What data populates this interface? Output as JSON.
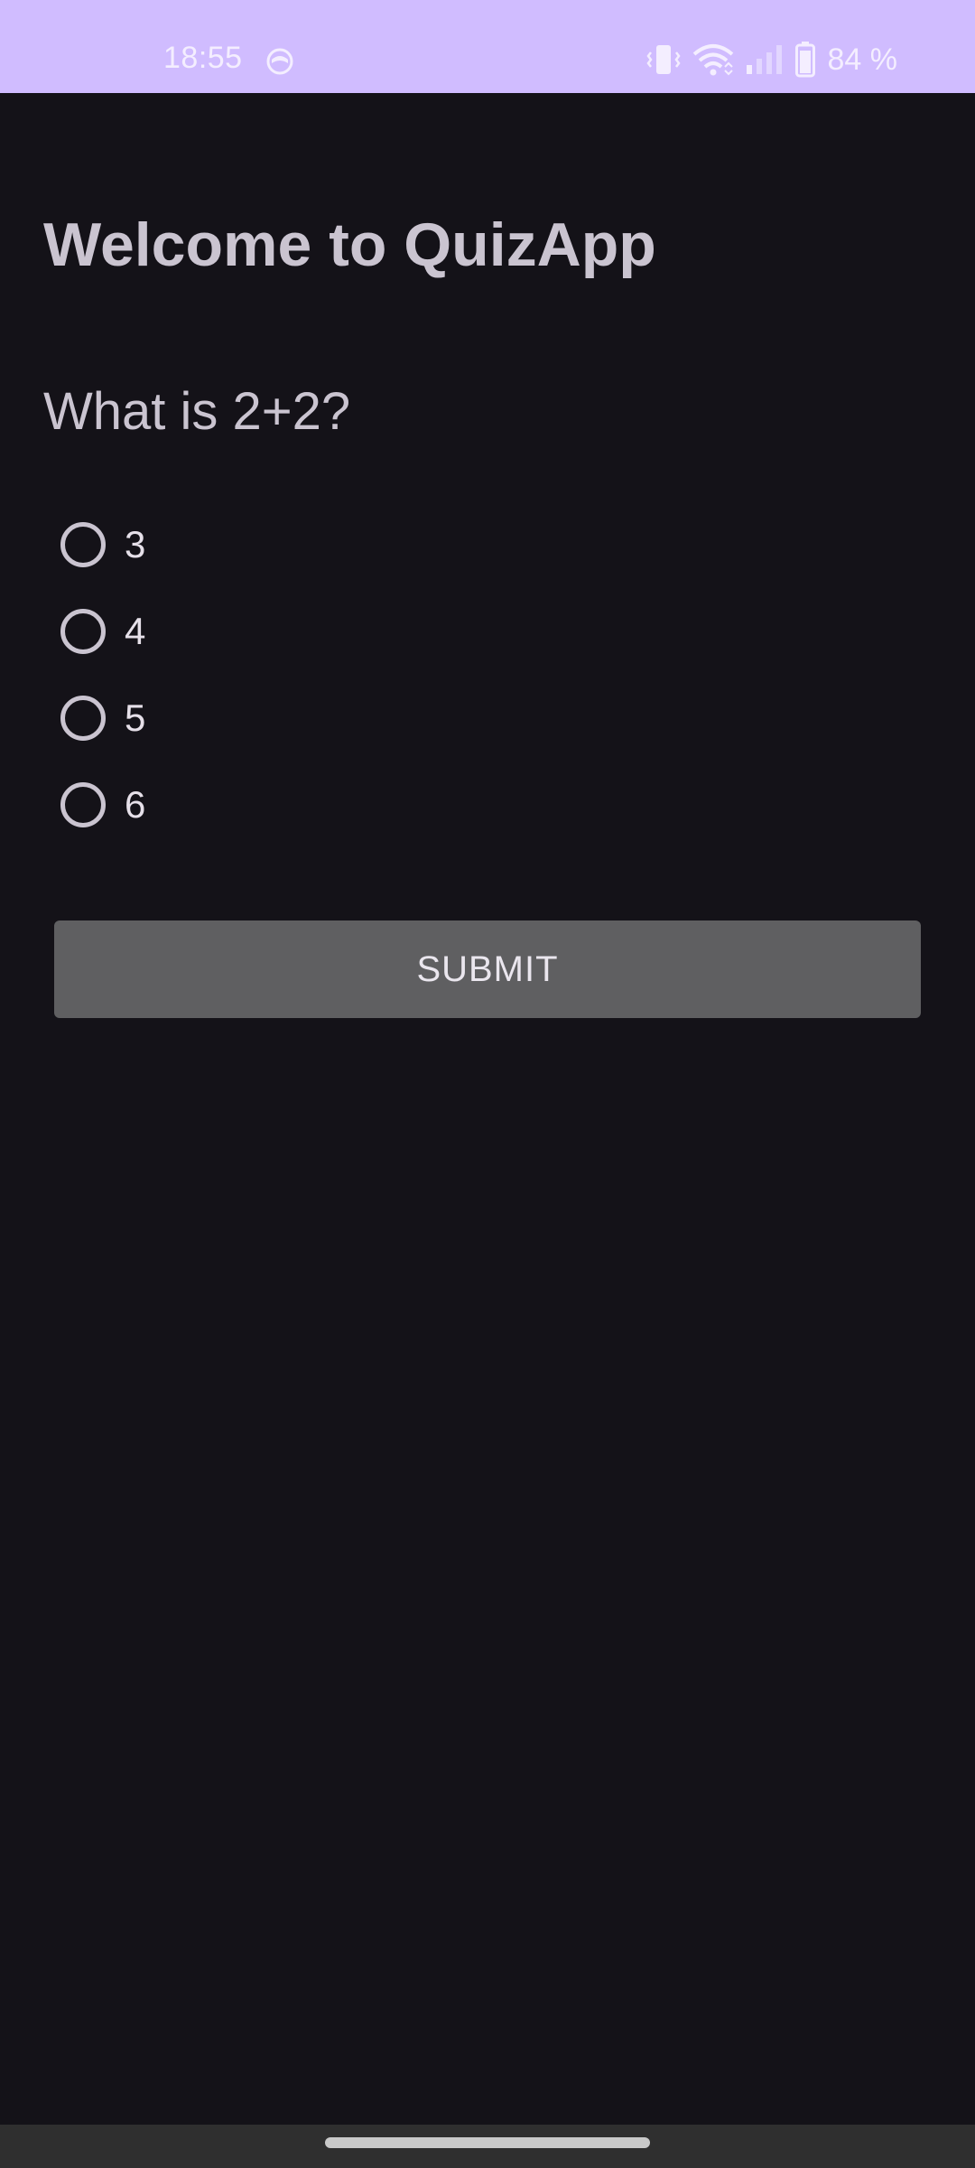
{
  "status_bar": {
    "time": "18:55",
    "battery_percent": "84 %",
    "background_color": "#D0BCFF",
    "icons": [
      "app-notification-icon",
      "vibrate-icon",
      "wifi-icon",
      "signal-icon",
      "battery-icon"
    ]
  },
  "main": {
    "title": "Welcome to QuizApp",
    "question": "What is 2+2?",
    "options": [
      {
        "label": "3",
        "selected": false
      },
      {
        "label": "4",
        "selected": false
      },
      {
        "label": "5",
        "selected": false
      },
      {
        "label": "6",
        "selected": false
      }
    ],
    "submit_label": "SUBMIT"
  },
  "colors": {
    "background": "#141218",
    "text_primary": "#CAC4D0",
    "button_background": "#5F5F61",
    "nav_bar": "#2F2F2F"
  }
}
